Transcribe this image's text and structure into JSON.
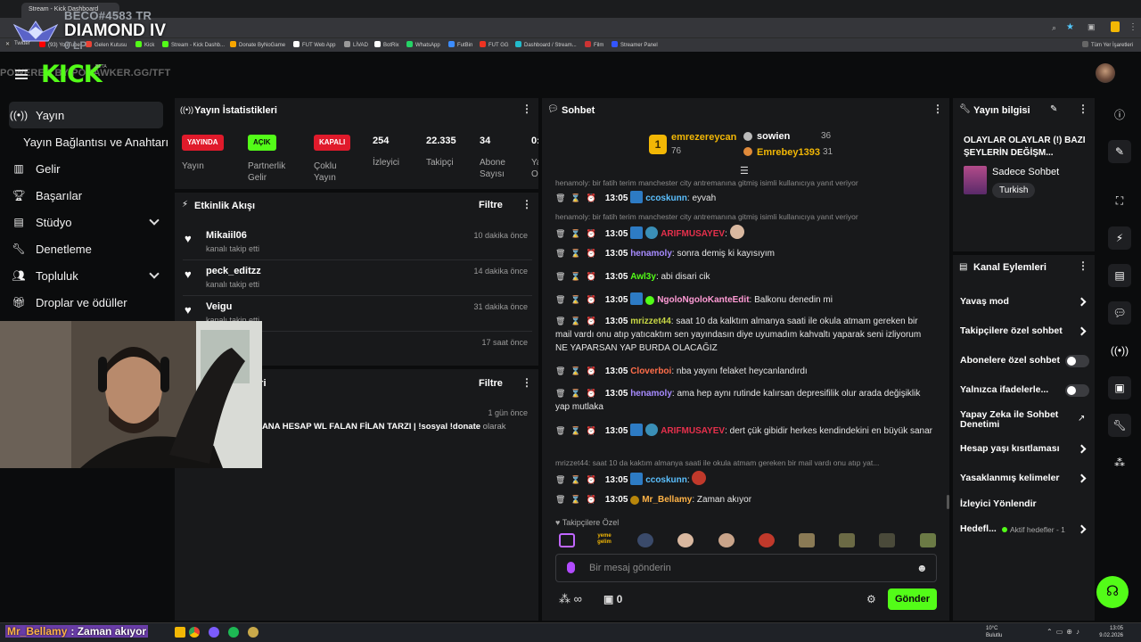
{
  "browser": {
    "tabs": [
      {
        "label": "Stream - Kick Dashboard"
      }
    ],
    "bookmarks": [
      "Twitter",
      "(93) YouTube",
      "Gelen Kutusu",
      "Kick",
      "Stream - Kick Dashb...",
      "Donate ByNoGame",
      "FUT Web App",
      "LİVAD",
      "BotRix",
      "WhatsApp",
      "FutBin",
      "FUT GG",
      "Dashboard / Stream...",
      "Film",
      "Streamer Panel",
      "Tüm Yer İşaretleri"
    ]
  },
  "overlay": {
    "rank_tag": "BECO#4583 TR",
    "rank_title": "DIAMOND IV",
    "rank_lp": "0 LP",
    "url_text": "POWERED BY PORAWKER.GG/TFT"
  },
  "header": {
    "logo": "KICK",
    "beta": "BETA"
  },
  "sidebar": {
    "items": [
      {
        "label": "Yayın",
        "icon": "broadcast-icon"
      },
      {
        "label": "Yayın Bağlantısı ve Anahtarı"
      },
      {
        "label": "Gelir",
        "icon": "chart-icon"
      },
      {
        "label": "Başarılar",
        "icon": "trophy-icon"
      },
      {
        "label": "Stüdyo",
        "icon": "studio-icon"
      },
      {
        "label": "Denetleme",
        "icon": "wrench-icon"
      },
      {
        "label": "Topluluk",
        "icon": "community-icon"
      },
      {
        "label": "Droplar ve ödüller",
        "icon": "gift-icon"
      }
    ]
  },
  "stats": {
    "title": "Yayın İstatistikleri",
    "badges": [
      {
        "text": "YAYINDA",
        "label": "Yayın",
        "color": "#e01a2b"
      },
      {
        "text": "AÇIK",
        "label": "Partnerlik Gelir",
        "color": "#53fc18"
      },
      {
        "text": "KAPALI",
        "label": "Çoklu Yayın",
        "color": "#e01a2b"
      }
    ],
    "numbers": [
      {
        "value": "254",
        "label": "İzleyici"
      },
      {
        "value": "22.335",
        "label": "Takipçi"
      },
      {
        "value": "34",
        "label": "Abone Sayısı"
      },
      {
        "value": "0:",
        "label": "Ya O"
      }
    ]
  },
  "activity": {
    "title": "Etkinlik Akışı",
    "filter": "Filtre",
    "items": [
      {
        "name": "Mikaiil06",
        "sub": "kanalı takip etti",
        "time": "10 dakika önce"
      },
      {
        "name": "peck_editzz",
        "sub": "kanalı takip etti",
        "time": "14 dakika önce"
      },
      {
        "name": "Veigu",
        "sub": "kanalı takip etti",
        "time": "31 dakika önce"
      },
      {
        "name": "",
        "sub": "",
        "time": "17 saat önce"
      }
    ]
  },
  "panel2": {
    "title_visible": "leri",
    "filter": "Filtre",
    "time": "1 gün önce",
    "text_prefix": "n",
    "text_bold": "ANA HESAP WL FALAN FİLAN TARZI | !sosyal !donate",
    "text_suffix": "olarak"
  },
  "chat": {
    "title": "Sohbet",
    "leaders": [
      {
        "rank": "1",
        "name": "emrezereycan",
        "count": "76"
      },
      {
        "name": "sowien",
        "count": "36"
      },
      {
        "name": "Emrebey1393",
        "count": "31"
      }
    ],
    "lines": [
      {
        "reply": "henamoly: bir fatih terim manchester city antremanına gitmiş isimli kullanıcıya yanıt veriyor",
        "time": "13:05",
        "user": "ccoskunn",
        "color": "#5bc0ff",
        "msg": "eyvah"
      },
      {
        "reply": "henamoly: bir fatih terim manchester city antremanına gitmiş isimli kullanıcıya yanıt veriyor",
        "time": "13:05",
        "user": "ARIFMUSAYEV",
        "color": "#e6304c",
        "msg": ""
      },
      {
        "time": "13:05",
        "user": "henamoly",
        "color": "#a78bff",
        "msg": "sonra demiş ki kayısıyım"
      },
      {
        "time": "13:05",
        "user": "Awl3y",
        "color": "#53fc18",
        "msg": "abi disari cik"
      },
      {
        "time": "13:05",
        "user": "NgoloNgoloKanteEdit",
        "color": "#ff9bd5",
        "msg": "Balkonu denedin mi"
      },
      {
        "time": "13:05",
        "user": "mrizzet44",
        "color": "#c9d845",
        "msg": "saat 10 da kalktım almanya saati ile okula atmam gereken bir mail vardı onu atıp yatıcaktım sen yayındasın diye uyumadım kahvaltı yaparak seni izliyorum NE YAPARSAN YAP BURDA OLACAĞIZ"
      },
      {
        "time": "13:05",
        "user": "Cloverboi",
        "color": "#ff6e4a",
        "msg": "nba yayını felaket heycanlandırdı"
      },
      {
        "time": "13:05",
        "user": "henamoly",
        "color": "#a78bff",
        "msg": "ama hep aynı rutinde kalırsan depresifilik olur arada değişiklik yap mutlaka"
      },
      {
        "time": "13:05",
        "user": "ARIFMUSAYEV",
        "color": "#e6304c",
        "msg": "dert çük gibidir herkes kendindekini en büyük sanar"
      },
      {
        "reply": "mrizzet44: saat 10 da kaktım almanya saati ile okula atmam gereken bir mail vardı onu atıp yat...",
        "time": "13:05",
        "user": "ccoskunn",
        "color": "#5bc0ff",
        "msg": ""
      },
      {
        "time": "13:05",
        "user": "Mr_Bellamy",
        "color": "#ffb347",
        "msg": "Zaman akıyor"
      }
    ],
    "emote_section": "Takipçilere Özel",
    "emote_text": "yeme gelim",
    "input_placeholder": "Bir mesaj gönderin",
    "points": "∞",
    "cart_count": "0",
    "send": "Gönder"
  },
  "stream_info": {
    "title": "Yayın bilgisi",
    "stream_title": "OLAYLAR OLAYLAR (!) BAZI ŞEYLERİN DEĞİŞM...",
    "category": "Sadece Sohbet",
    "language": "Turkish"
  },
  "channel_actions": {
    "title": "Kanal Eylemleri",
    "items": [
      {
        "label": "Yavaş mod",
        "control": "chevron"
      },
      {
        "label": "Takipçilere özel sohbet",
        "control": "chevron"
      },
      {
        "label": "Abonelere özel sohbet",
        "control": "toggle"
      },
      {
        "label": "Yalnızca ifadelerle...",
        "control": "toggle"
      },
      {
        "label": "Yapay Zeka ile Sohbet Denetimi",
        "control": "external"
      },
      {
        "label": "Hesap yaşı kısıtlaması",
        "control": "chevron"
      },
      {
        "label": "Yasaklanmış kelimeler",
        "control": "chevron"
      },
      {
        "label": "İzleyici Yönlendir",
        "control": "none"
      },
      {
        "label": "Hedefl...",
        "control": "chevron",
        "extra": "Aktif hedefler - 1"
      }
    ]
  },
  "overlay_bottom": {
    "user": "Mr_Bellamy",
    "msg": ": Zaman akıyor"
  },
  "taskbar": {
    "weather": "10°C",
    "weather_sub": "Bulutlu",
    "time": "13:05",
    "date": "9.02.2026"
  }
}
